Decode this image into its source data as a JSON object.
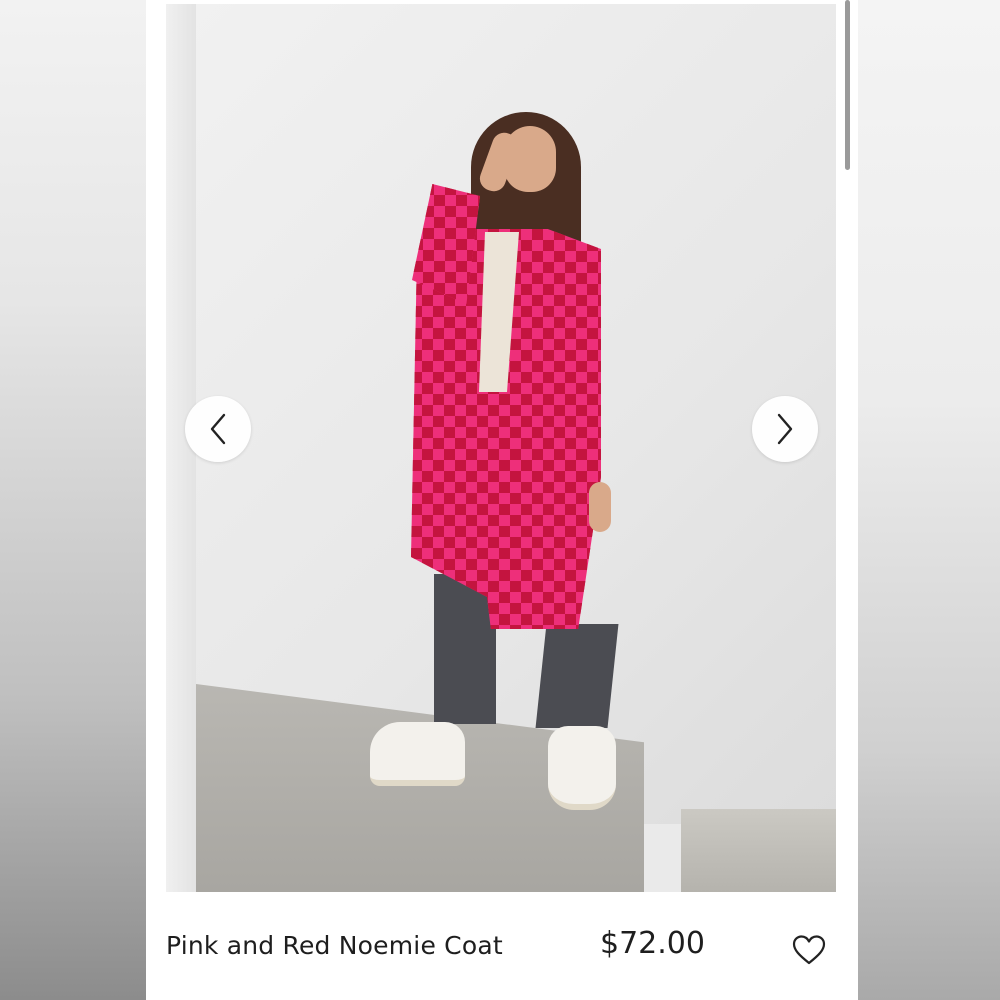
{
  "product": {
    "name": "Pink and Red Noemie Coat",
    "price": "$72.00"
  },
  "gallery": {
    "prev_icon": "chevron-left-icon",
    "next_icon": "chevron-right-icon"
  },
  "favorite": {
    "icon": "heart-outline-icon"
  },
  "colors": {
    "coat_pink": "#ee2f7a",
    "coat_red": "#c4143f",
    "text": "#1e1e1e"
  }
}
